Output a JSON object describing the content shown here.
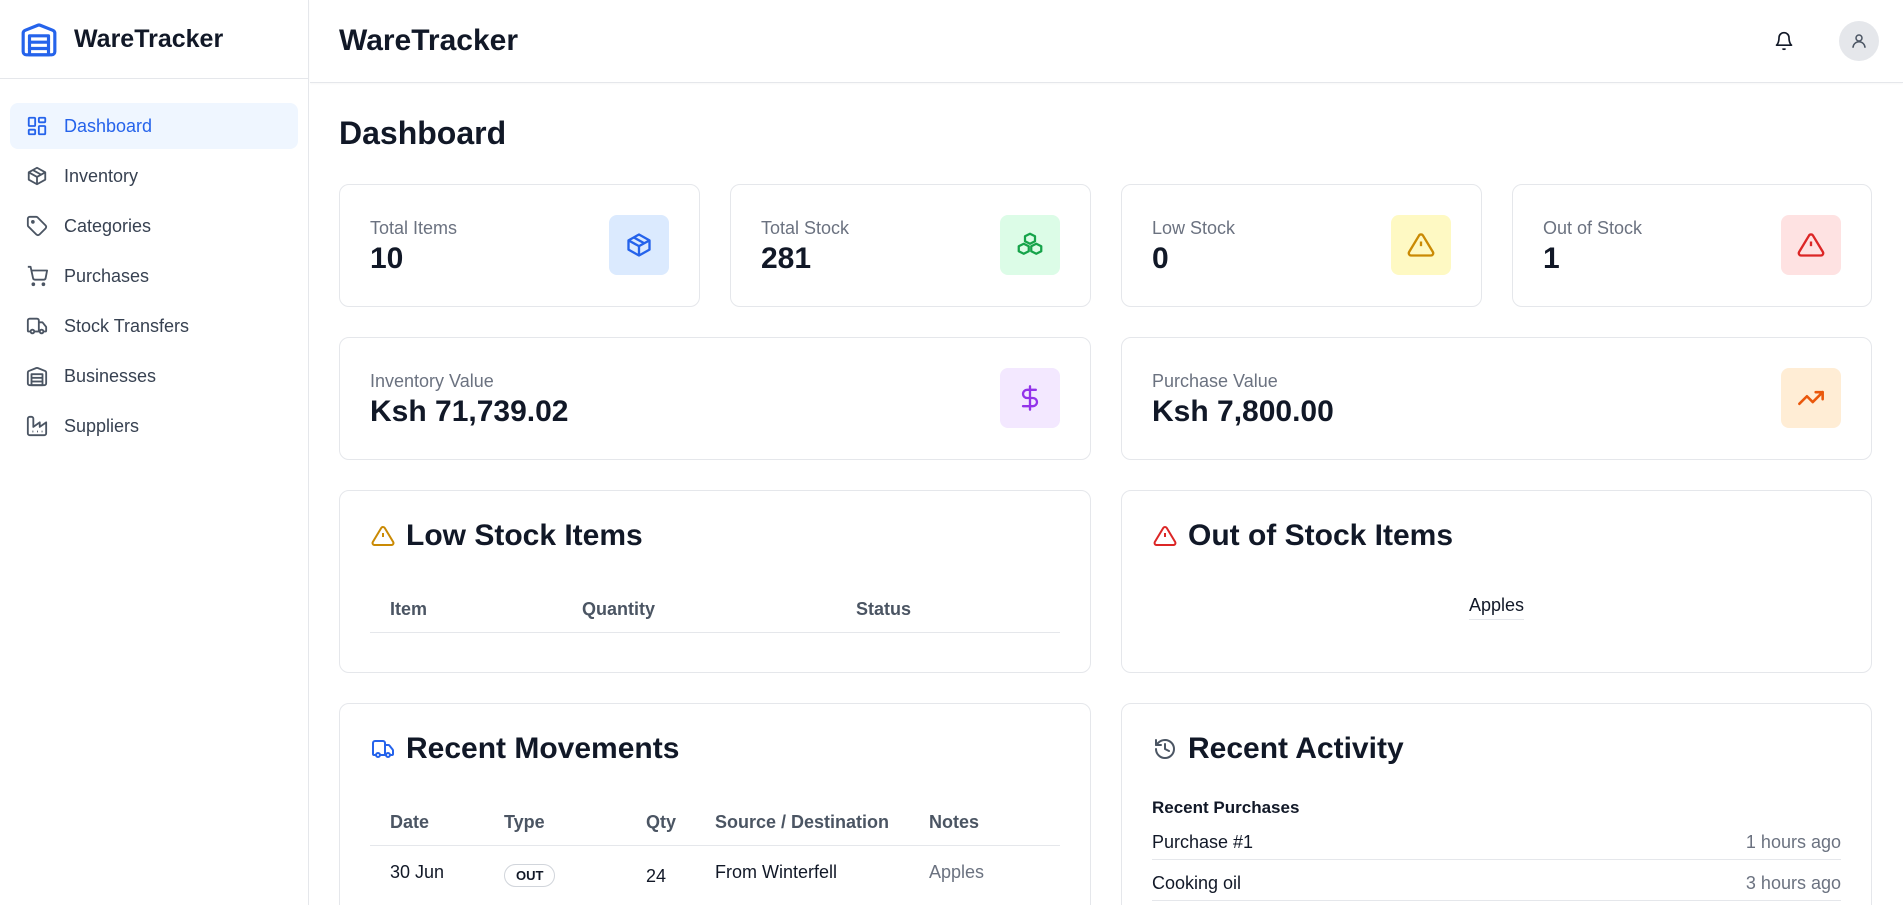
{
  "app": {
    "name": "WareTracker"
  },
  "header": {
    "title": "WareTracker"
  },
  "sidebar": {
    "items": [
      {
        "label": "Dashboard",
        "icon": "dashboard-icon",
        "active": true
      },
      {
        "label": "Inventory",
        "icon": "box-icon"
      },
      {
        "label": "Categories",
        "icon": "tag-icon"
      },
      {
        "label": "Purchases",
        "icon": "cart-icon"
      },
      {
        "label": "Stock Transfers",
        "icon": "truck-icon"
      },
      {
        "label": "Businesses",
        "icon": "warehouse-icon"
      },
      {
        "label": "Suppliers",
        "icon": "factory-icon"
      }
    ]
  },
  "page": {
    "title": "Dashboard"
  },
  "stats": {
    "total_items": {
      "label": "Total Items",
      "value": "10",
      "icon": "box-icon",
      "color": "#2563eb",
      "bg": "#dbeafe"
    },
    "total_stock": {
      "label": "Total Stock",
      "value": "281",
      "icon": "boxes-icon",
      "color": "#16a34a",
      "bg": "#dcfce7"
    },
    "low_stock": {
      "label": "Low Stock",
      "value": "0",
      "icon": "warning-icon",
      "color": "#ca8a04",
      "bg": "#fef9c3"
    },
    "out_of_stock": {
      "label": "Out of Stock",
      "value": "1",
      "icon": "alert-icon",
      "color": "#dc2626",
      "bg": "#fee2e2"
    },
    "inventory_value": {
      "label": "Inventory Value",
      "value": "Ksh 71,739.02",
      "icon": "dollar-icon",
      "color": "#9333ea",
      "bg": "#f3e8ff"
    },
    "purchase_value": {
      "label": "Purchase Value",
      "value": "Ksh 7,800.00",
      "icon": "trending-up-icon",
      "color": "#ea580c",
      "bg": "#ffedd5"
    }
  },
  "low_stock_items": {
    "title": "Low Stock Items",
    "columns": [
      "Item",
      "Quantity",
      "Status"
    ],
    "rows": []
  },
  "out_of_stock_items": {
    "title": "Out of Stock Items",
    "items": [
      "Apples"
    ]
  },
  "recent_movements": {
    "title": "Recent Movements",
    "columns": [
      "Date",
      "Type",
      "Qty",
      "Source / Destination",
      "Notes"
    ],
    "rows": [
      {
        "date": "30 Jun",
        "type": "OUT",
        "qty": "24",
        "source": "From Winterfell",
        "notes": "Apples"
      }
    ]
  },
  "recent_activity": {
    "title": "Recent Activity",
    "subtitle": "Recent Purchases",
    "items": [
      {
        "name": "Purchase #1",
        "time": "1 hours ago"
      },
      {
        "name": "Cooking oil",
        "time": "3 hours ago"
      }
    ]
  }
}
